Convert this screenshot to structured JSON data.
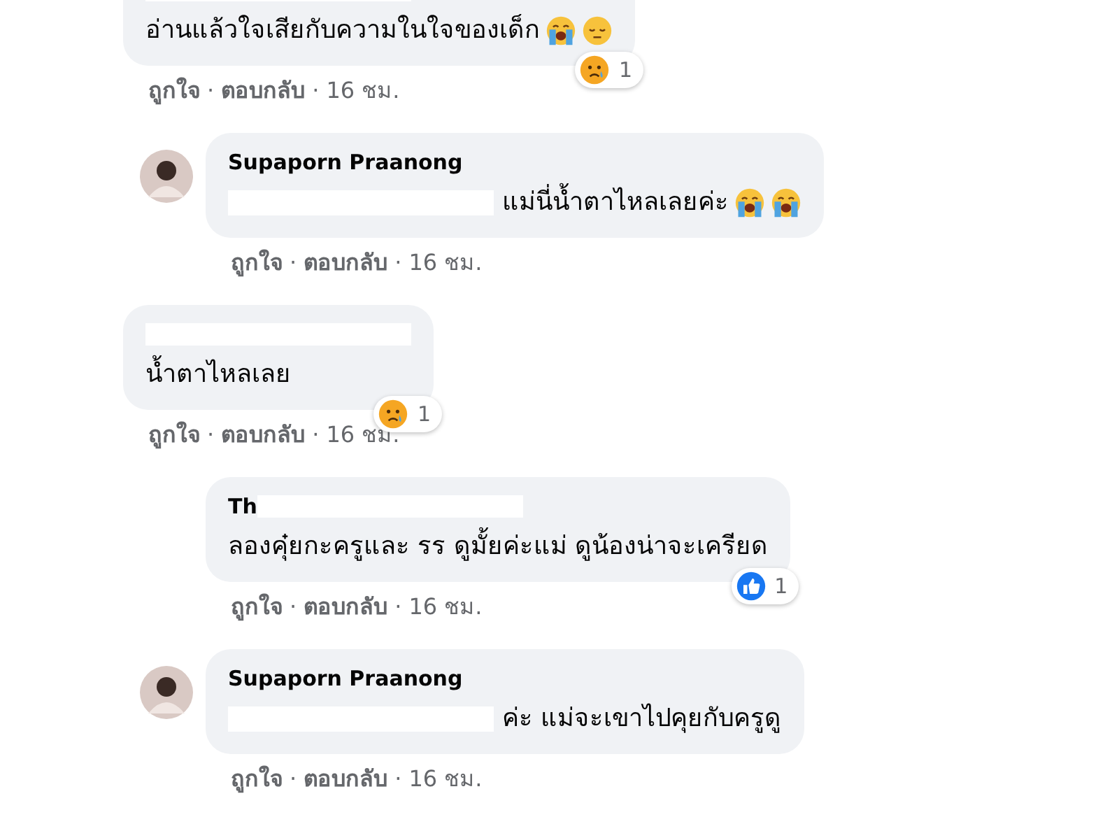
{
  "comments": [
    {
      "kind": "top",
      "author_redacted": true,
      "body_redacted_prefix": false,
      "body": "อ่านแล้วใจเสียกับความในใจของเด็ก",
      "emojis": [
        {
          "kind": "crying"
        },
        {
          "kind": "pensive"
        }
      ],
      "reaction": {
        "kind": "sad",
        "count": "1"
      },
      "meta": [
        {
          "kind": "link",
          "text": "ถูกใจ"
        },
        {
          "kind": "sep",
          "text": "·"
        },
        {
          "kind": "link",
          "text": "ตอบกลับ"
        },
        {
          "kind": "sep",
          "text": "·"
        },
        {
          "kind": "time",
          "text": "16 ชม."
        }
      ]
    },
    {
      "kind": "reply",
      "avatar": true,
      "author": "Supaporn Praanong",
      "author_redacted": false,
      "body_redacted_prefix": true,
      "body": "แม่นี่น้ำตาไหลเลยค่ะ",
      "emojis": [
        {
          "kind": "crying"
        },
        {
          "kind": "crying"
        }
      ],
      "meta": [
        {
          "kind": "link",
          "text": "ถูกใจ"
        },
        {
          "kind": "sep",
          "text": "·"
        },
        {
          "kind": "link",
          "text": "ตอบกลับ"
        },
        {
          "kind": "sep",
          "text": "·"
        },
        {
          "kind": "time",
          "text": "16 ชม."
        }
      ]
    },
    {
      "kind": "top",
      "author_redacted": true,
      "body_redacted_prefix": false,
      "body": "น้ำตาไหลเลย",
      "reaction": {
        "kind": "sad",
        "count": "1"
      },
      "meta": [
        {
          "kind": "link",
          "text": "ถูกใจ"
        },
        {
          "kind": "sep",
          "text": "·"
        },
        {
          "kind": "link",
          "text": "ตอบกลับ"
        },
        {
          "kind": "sep",
          "text": "·"
        },
        {
          "kind": "time",
          "text": "16 ชม."
        }
      ]
    },
    {
      "kind": "reply",
      "avatar": false,
      "author": "Th",
      "author_redacted": true,
      "body_redacted_prefix": false,
      "body": "ลองคุ๋ยกะครูและ รร ดูมั้ยค่ะแม่ ดูน้องน่าจะเครียด",
      "reaction": {
        "kind": "like",
        "count": "1"
      },
      "meta": [
        {
          "kind": "link",
          "text": "ถูกใจ"
        },
        {
          "kind": "sep",
          "text": "·"
        },
        {
          "kind": "link",
          "text": "ตอบกลับ"
        },
        {
          "kind": "sep",
          "text": "·"
        },
        {
          "kind": "time",
          "text": "16 ชม."
        }
      ]
    },
    {
      "kind": "reply",
      "avatar": true,
      "author": "Supaporn Praanong",
      "author_redacted": false,
      "body_redacted_prefix": true,
      "body": "ค่ะ แม่จะเขาไปคุยกับครูดู",
      "meta": [
        {
          "kind": "link",
          "text": "ถูกใจ"
        },
        {
          "kind": "sep",
          "text": "·"
        },
        {
          "kind": "link",
          "text": "ตอบกลับ"
        },
        {
          "kind": "sep",
          "text": "·"
        },
        {
          "kind": "time",
          "text": "16 ชม."
        }
      ]
    }
  ]
}
